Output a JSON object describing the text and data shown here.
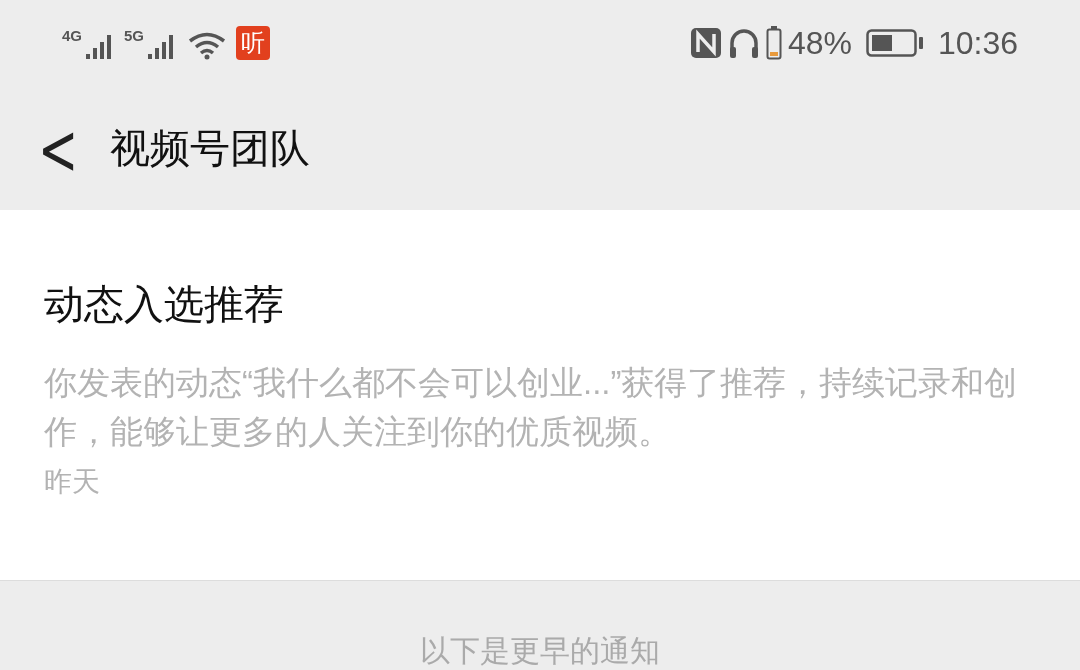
{
  "status_bar": {
    "network_1": "4G",
    "network_2": "5G",
    "app_badge": "听",
    "battery_percent": "48%",
    "time": "10:36"
  },
  "header": {
    "back_icon": "<",
    "title": "视频号团队"
  },
  "notification": {
    "title": "动态入选推荐",
    "body": "你发表的动态“我什么都不会可以创业...”获得了推荐，持续记录和创作，能够让更多的人关注到你的优质视频。",
    "time": "昨天"
  },
  "divider_text": "以下是更早的通知"
}
